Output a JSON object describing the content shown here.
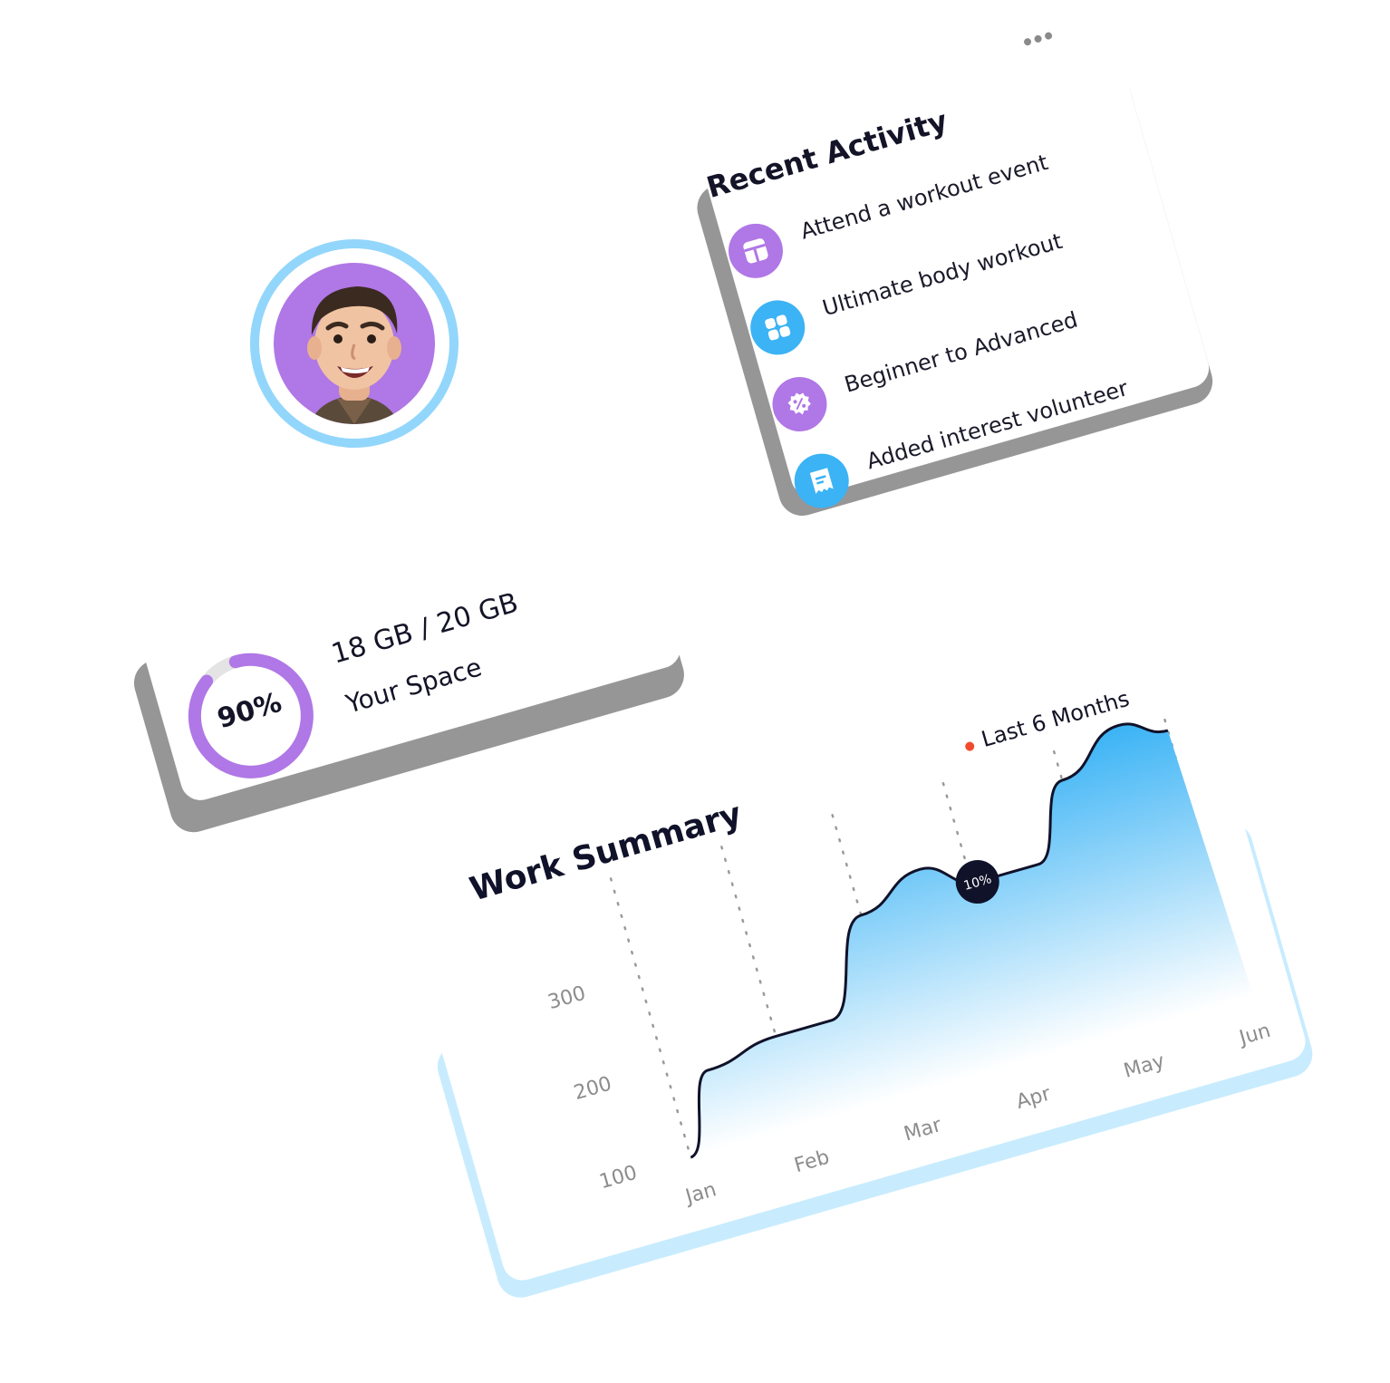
{
  "profile": {
    "avatar_ring_color": "#93d6fb",
    "avatar_bg_color": "#b077e6"
  },
  "recent_activity": {
    "title": "Recent Activity",
    "more_icon": "more-horizontal-icon",
    "items": [
      {
        "label": "Attend a workout event",
        "icon": "layout-icon",
        "color": "#b077e6"
      },
      {
        "label": "Ultimate body workout",
        "icon": "grid-icon",
        "color": "#3bb3f5"
      },
      {
        "label": "Beginner to Advanced",
        "icon": "discount-badge-icon",
        "color": "#b077e6"
      },
      {
        "label": "Added interest volunteer",
        "icon": "receipt-icon",
        "color": "#3bb3f5"
      }
    ]
  },
  "storage": {
    "used": "18 GB / 20 GB",
    "caption": "Your Space",
    "percent_label": "90%",
    "percent": 90,
    "ring_color": "#b077e6",
    "track_color": "#e4e4e4"
  },
  "work_summary": {
    "title": "Work Summary",
    "legend_label": "Last 6 Months",
    "legend_color": "#f24a2c",
    "marker_label": "10%",
    "chart_data": {
      "type": "area",
      "title": "Work Summary",
      "categories": [
        "Jan",
        "Feb",
        "Mar",
        "Apr",
        "May",
        "Jun"
      ],
      "y_ticks": [
        "300",
        "200",
        "100"
      ],
      "ylim": [
        100,
        300
      ],
      "legend": "top-right",
      "series": [
        {
          "name": "Last 6 Months",
          "x": [
            0,
            0.35,
            1,
            1.5,
            2,
            2.6,
            3.05,
            3.6,
            4,
            4.6,
            5
          ],
          "y": [
            100,
            185,
            200,
            200,
            300,
            330,
            300,
            300,
            380,
            420,
            400
          ]
        }
      ],
      "highlight": {
        "x": 3.05,
        "y": 300,
        "label": "10%"
      },
      "area_gradient": [
        "#3bb3f5",
        "#ffffff"
      ],
      "grid": "vertical-dotted"
    }
  }
}
